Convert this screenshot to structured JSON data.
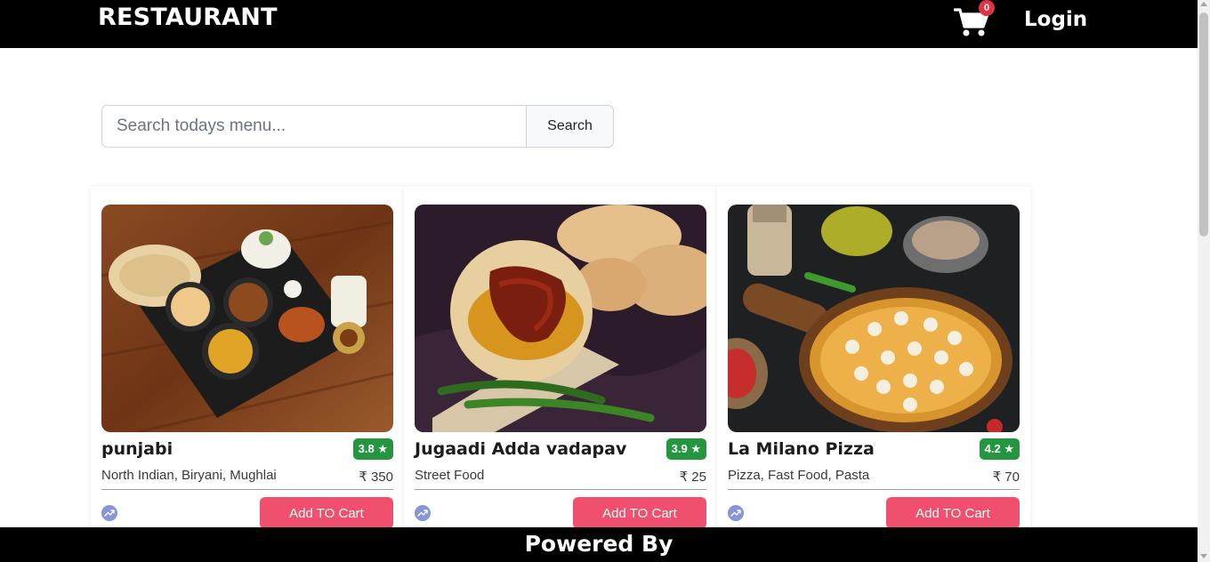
{
  "navbar": {
    "brand": "RESTAURANT",
    "cart_icon": "cart-icon",
    "cart_count": "0",
    "login_label": "Login"
  },
  "search": {
    "placeholder": "Search todays menu...",
    "button_label": "Search"
  },
  "restaurants": [
    {
      "name": "punjabi",
      "rating": "3.8 ★",
      "cuisine": "North Indian, Biryani, Mughlai",
      "price": "₹ 350",
      "image": "thali-photo",
      "add_label": "Add TO Cart",
      "trend_icon": "trending-icon"
    },
    {
      "name": "Jugaadi Adda vadapav",
      "rating": "3.9 ★",
      "cuisine": "Street Food",
      "price": "₹ 25",
      "image": "vadapav-photo",
      "add_label": "Add TO Cart",
      "trend_icon": "trending-icon"
    },
    {
      "name": "La Milano Pizza",
      "rating": "4.2 ★",
      "cuisine": "Pizza, Fast Food, Pasta",
      "price": "₹ 70",
      "image": "pizza-photo",
      "add_label": "Add TO Cart",
      "trend_icon": "trending-icon"
    }
  ],
  "footer": {
    "text": "Powered By"
  },
  "colors": {
    "navbar": "#000000",
    "rating": "#24963f",
    "add_button": "#f0506e",
    "trend_icon": "#8a95d6"
  }
}
